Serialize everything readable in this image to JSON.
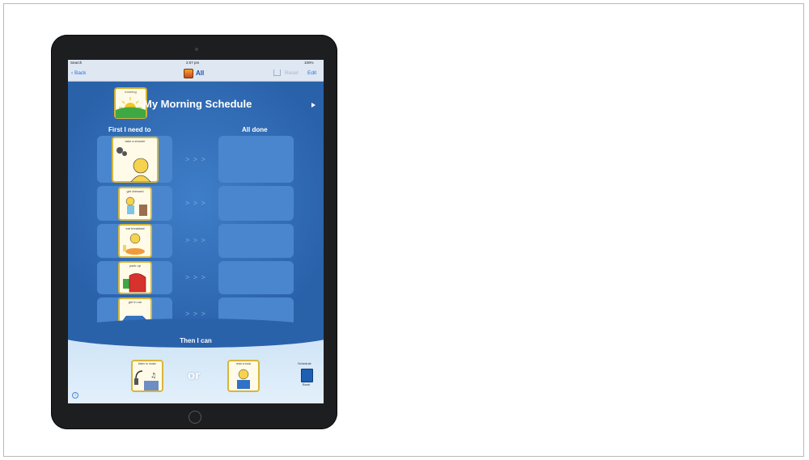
{
  "status_bar": {
    "carrier": "Search",
    "time": "2:07 pm",
    "battery": "100%"
  },
  "nav": {
    "back_label": "Back",
    "title": "All",
    "reset_label": "Reset",
    "edit_label": "Edit"
  },
  "schedule": {
    "icon_caption": "morning",
    "title": "My Morning Schedule",
    "first_header": "First I need to",
    "done_header": "All done",
    "tasks": [
      {
        "label": "take a shower",
        "icon": "shower-icon"
      },
      {
        "label": "get dressed",
        "icon": "dressing-icon"
      },
      {
        "label": "eat breakfast",
        "icon": "breakfast-icon"
      },
      {
        "label": "pack up",
        "icon": "backpack-icon"
      },
      {
        "label": "get in car",
        "icon": "car-icon"
      }
    ],
    "arrows": "> > >",
    "then_label": "Then I can",
    "rewards": [
      {
        "label": "listen to music",
        "icon": "music-icon"
      },
      {
        "label": "read a book",
        "icon": "reading-icon"
      }
    ],
    "or_label": "or",
    "schedule_book_top": "Schedule",
    "schedule_book_bottom": "Book"
  },
  "colors": {
    "accent": "#2b6bb5",
    "card_border": "#d8b63a",
    "bar": "#dfe7f2"
  }
}
